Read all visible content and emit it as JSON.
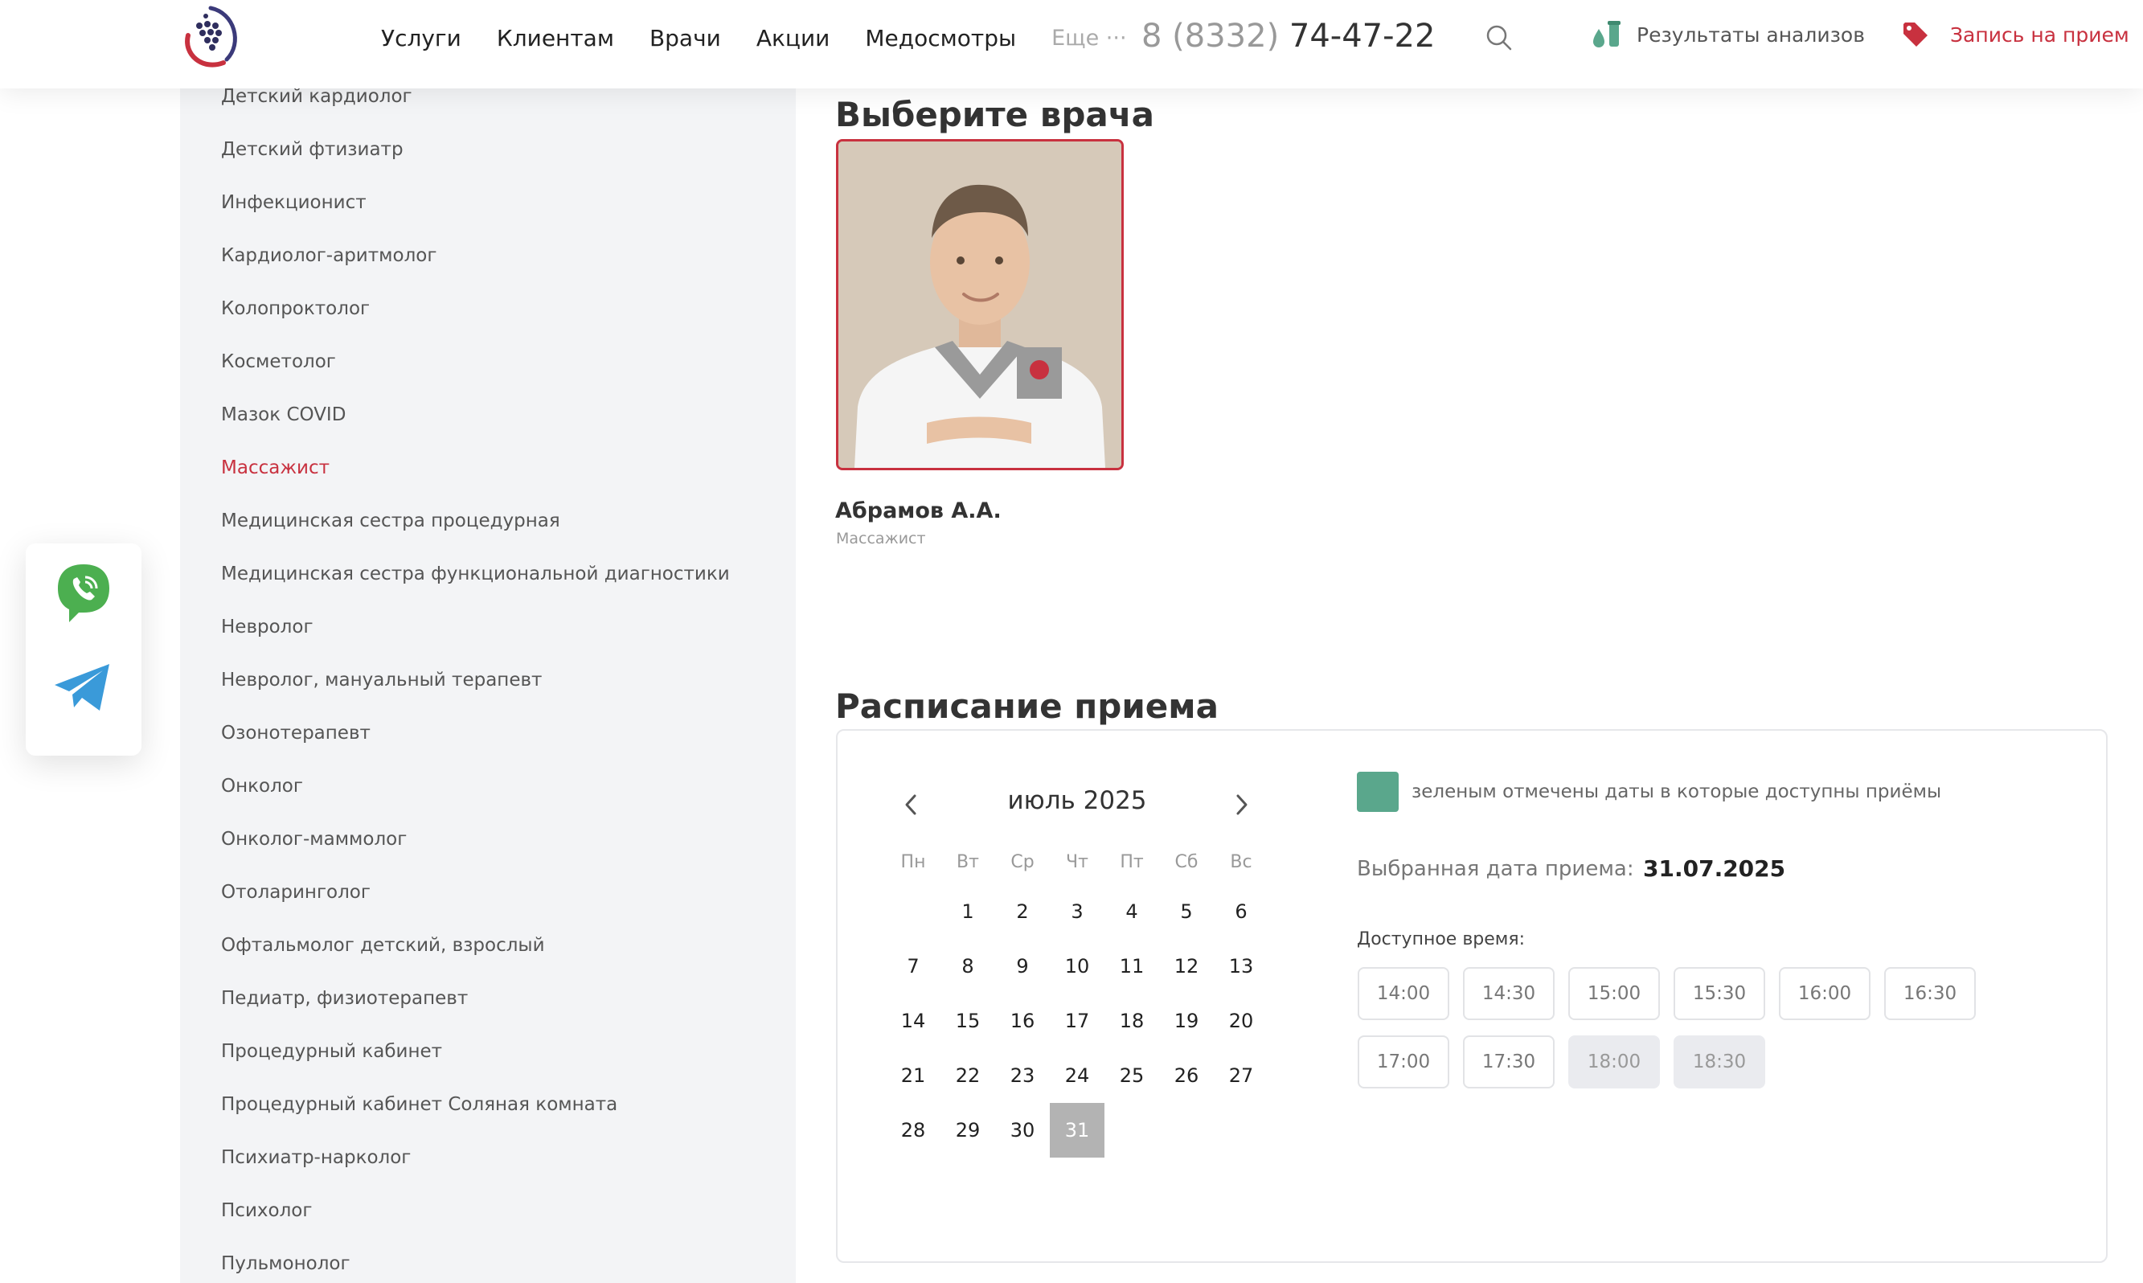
{
  "header": {
    "nav": [
      "Услуги",
      "Клиентам",
      "Врачи",
      "Акции",
      "Медосмотры"
    ],
    "more_label": "Еще ···",
    "phone_code": "8 (8332)",
    "phone_number": "74-47-22",
    "results_label": "Результаты анализов",
    "appointment_label": "Запись на прием"
  },
  "sidebar": {
    "items": [
      "Детский кардиолог",
      "Детский фтизиатр",
      "Инфекционист",
      "Кардиолог-аритмолог",
      "Колопроктолог",
      "Косметолог",
      "Мазок COVID",
      "Массажист",
      "Медицинская сестра процедурная",
      "Медицинская сестра функциональной диагностики",
      "Невролог",
      "Невролог, мануальный терапевт",
      "Озонотерапевт",
      "Онколог",
      "Онколог-маммолог",
      "Отоларинголог",
      "Офтальмолог детский, взрослый",
      "Педиатр, физиотерапевт",
      "Процедурный кабинет",
      "Процедурный кабинет Соляная комната",
      "Психиатр-нарколог",
      "Психолог",
      "Пульмонолог"
    ],
    "active": "Массажист"
  },
  "doctor_section": {
    "title": "Выберите врача",
    "doctor_name": "Абрамов А.А.",
    "doctor_specialty": "Массажист"
  },
  "schedule": {
    "title": "Расписание приема",
    "month_label": "июль 2025",
    "weekdays": [
      "Пн",
      "Вт",
      "Ср",
      "Чт",
      "Пт",
      "Сб",
      "Вс"
    ],
    "first_weekday_index": 1,
    "days_in_month": 31,
    "selected_day": 31,
    "legend_text": "зеленым отмечены даты в которые доступны приёмы",
    "legend_color": "#5aa78c",
    "selected_date_label": "Выбранная дата приема:",
    "selected_date_value": "31.07.2025",
    "available_time_label": "Доступное время:",
    "slots": [
      {
        "time": "14:00",
        "busy": false
      },
      {
        "time": "14:30",
        "busy": false
      },
      {
        "time": "15:00",
        "busy": false
      },
      {
        "time": "15:30",
        "busy": false
      },
      {
        "time": "16:00",
        "busy": false
      },
      {
        "time": "16:30",
        "busy": false
      },
      {
        "time": "17:00",
        "busy": false
      },
      {
        "time": "17:30",
        "busy": false
      },
      {
        "time": "18:00",
        "busy": true
      },
      {
        "time": "18:30",
        "busy": true
      }
    ]
  },
  "colors": {
    "accent": "#c8313f",
    "green": "#5aa78c",
    "sidebar_bg": "#f3f4f6"
  }
}
